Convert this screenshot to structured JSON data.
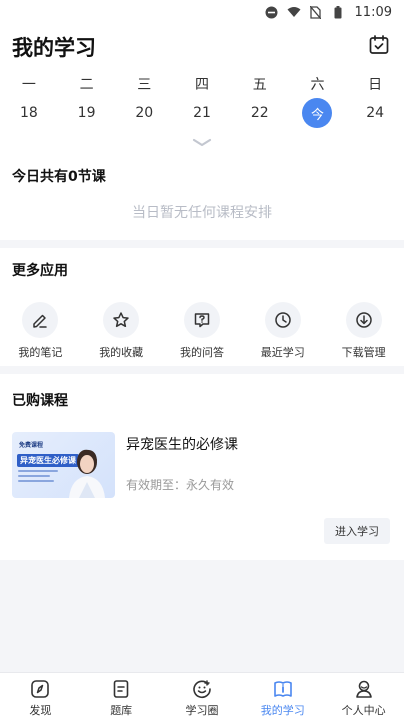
{
  "status_bar": {
    "time": "11:09"
  },
  "header": {
    "title": "我的学习"
  },
  "calendar": {
    "weekdays": [
      "一",
      "二",
      "三",
      "四",
      "五",
      "六",
      "日"
    ],
    "dates": [
      "18",
      "19",
      "20",
      "21",
      "22",
      "今",
      "24"
    ],
    "today_index": 5
  },
  "today": {
    "count_text": "今日共有0节课",
    "empty_text": "当日暂无任何课程安排"
  },
  "apps": {
    "title": "更多应用",
    "items": [
      {
        "label": "我的笔记",
        "icon": "pen-icon"
      },
      {
        "label": "我的收藏",
        "icon": "star-icon"
      },
      {
        "label": "我的问答",
        "icon": "question-icon"
      },
      {
        "label": "最近学习",
        "icon": "clock-icon"
      },
      {
        "label": "下载管理",
        "icon": "download-icon"
      }
    ]
  },
  "courses": {
    "title": "已购课程",
    "items": [
      {
        "title": "异宠医生的必修课",
        "valid_text": "有效期至：永久有效",
        "thumb_tag": "免费课程",
        "thumb_title": "异宠医生必修课",
        "enter_label": "进入学习"
      }
    ]
  },
  "tabbar": {
    "items": [
      {
        "label": "发现",
        "icon": "compass-icon"
      },
      {
        "label": "题库",
        "icon": "document-icon"
      },
      {
        "label": "学习圈",
        "icon": "smile-icon"
      },
      {
        "label": "我的学习",
        "icon": "book-icon"
      },
      {
        "label": "个人中心",
        "icon": "person-icon"
      }
    ],
    "active_index": 3,
    "active_color": "#4a87f0"
  }
}
